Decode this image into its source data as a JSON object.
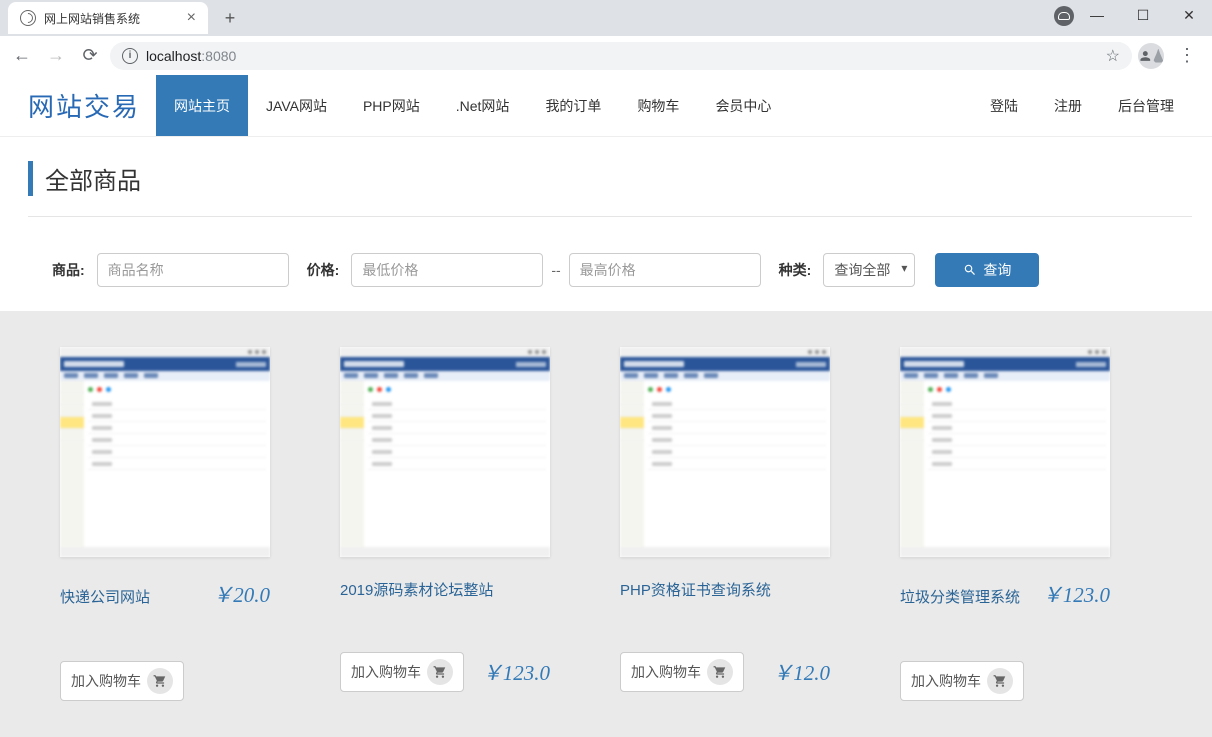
{
  "browser": {
    "tab_title": "网上网站销售系统",
    "url_host": "localhost",
    "url_port": ":8080"
  },
  "nav": {
    "brand": "网站交易",
    "items": [
      "网站主页",
      "JAVA网站",
      "PHP网站",
      ".Net网站",
      "我的订单",
      "购物车",
      "会员中心"
    ],
    "right_items": [
      "登陆",
      "注册",
      "后台管理"
    ]
  },
  "section_title": "全部商品",
  "filter": {
    "label_product": "商品:",
    "placeholder_name": "商品名称",
    "label_price": "价格:",
    "placeholder_min": "最低价格",
    "separator": "--",
    "placeholder_max": "最高价格",
    "label_category": "种类:",
    "select_value": "查询全部",
    "search_label": "查询"
  },
  "products": [
    {
      "name": "快递公司网站",
      "price": "￥20.0",
      "cart_label": "加入购物车",
      "layout": "inline"
    },
    {
      "name": "2019源码素材论坛整站",
      "price": "￥123.0",
      "cart_label": "加入购物车",
      "layout": "below"
    },
    {
      "name": "PHP资格证书查询系统",
      "price": "￥12.0",
      "cart_label": "加入购物车",
      "layout": "below"
    },
    {
      "name": "垃圾分类管理系统",
      "price": "￥123.0",
      "cart_label": "加入购物车",
      "layout": "inline"
    }
  ]
}
